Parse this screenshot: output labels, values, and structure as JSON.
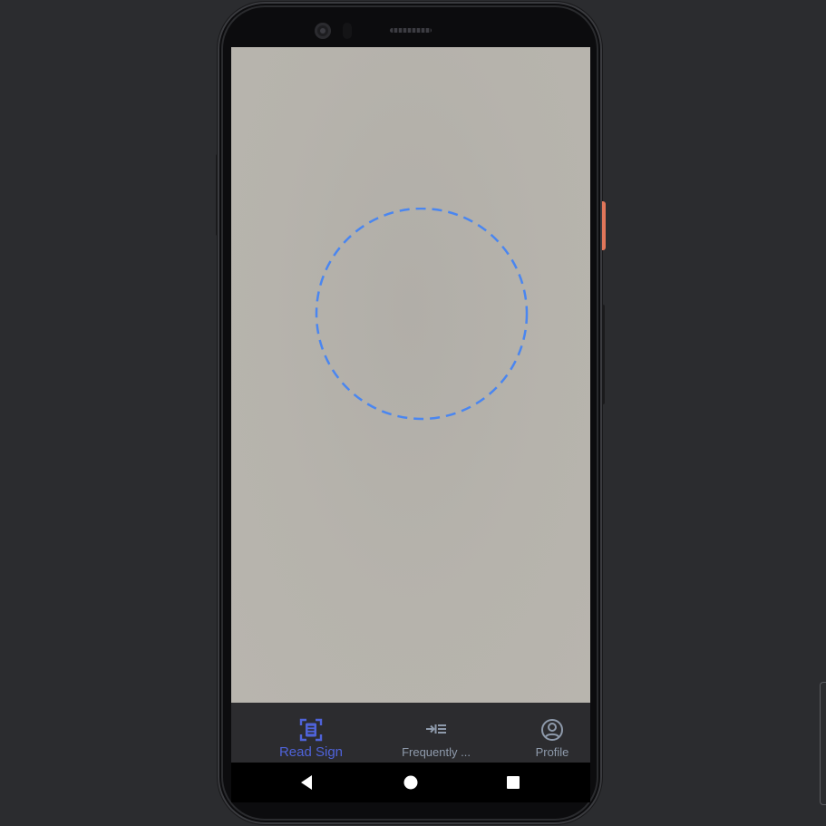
{
  "bottom_nav": {
    "items": [
      {
        "label": "Read Sign",
        "icon": "document-scan-icon",
        "active": true
      },
      {
        "label": "Frequently ...",
        "icon": "list-indent-icon",
        "active": false
      },
      {
        "label": "Profile",
        "icon": "account-circle-icon",
        "active": false
      }
    ]
  },
  "system_nav": {
    "back_icon": "back-triangle-icon",
    "home_icon": "home-circle-icon",
    "recent_icon": "recent-square-icon"
  },
  "colors": {
    "accent": "#4f63d9",
    "scan_ring": "#4a86f0",
    "inactive": "#8e9aab",
    "viewfinder": "#b5b2ab",
    "nav_bg": "#2c2c2f",
    "background": "#2b2c2f",
    "power_button": "#e0765a"
  }
}
